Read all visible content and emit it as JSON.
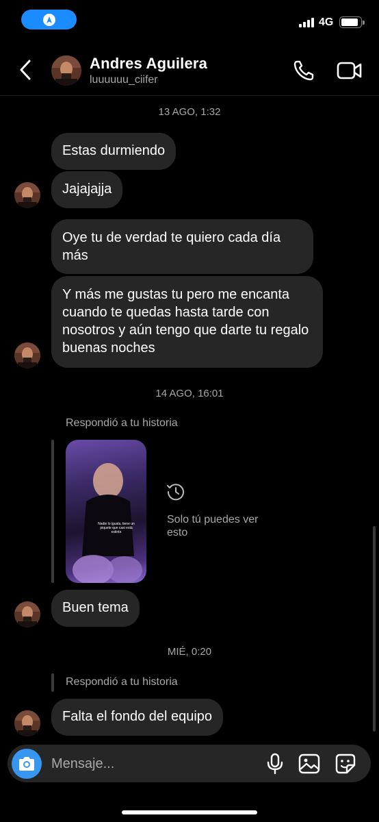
{
  "status_bar": {
    "network": "4G",
    "battery_level": 0.9
  },
  "header": {
    "contact_name": "Andres Aguilera",
    "username": "luuuuuu_ciifer"
  },
  "timestamps": [
    "13 AGO, 1:32",
    "14 AGO, 16:01",
    "MIÉ, 0:20"
  ],
  "messages": [
    {
      "text": "Estas durmiendo"
    },
    {
      "text": "Jajajajja"
    },
    {
      "text": "Oye tu de verdad te quiero cada día más"
    },
    {
      "text": "Y más me gustas tu pero me encanta cuando te quedas hasta tarde con nosotros y aún tengo que darte tu regalo buenas noches"
    },
    {
      "text": "Buen tema"
    },
    {
      "text": "Falta el fondo del equipo"
    }
  ],
  "story_reply": {
    "label": "Respondió a tu historia",
    "story_caption": "Nadie lo iguala, tiene un piquete que casi está extinto",
    "notice": "Solo tú puedes ver esto"
  },
  "story_reply_2": {
    "label": "Respondió a tu historia"
  },
  "composer": {
    "placeholder": "Mensaje..."
  },
  "colors": {
    "bubble": "#262626",
    "accent": "#3797f0",
    "background": "#000000",
    "muted_text": "#a8a8a8"
  }
}
